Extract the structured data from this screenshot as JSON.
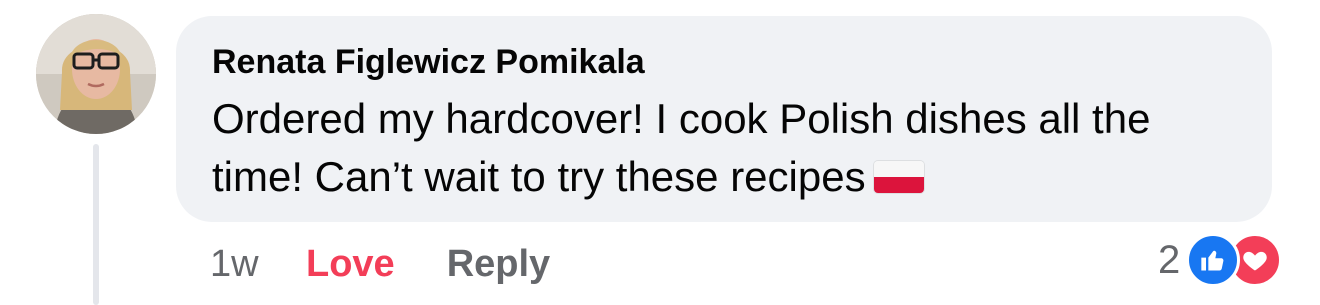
{
  "comment": {
    "author": "Renata Figlewicz Pomikala",
    "text": "Ordered my hardcover! I cook Polish dishes all the time! Can’t wait to try these recipes",
    "emoji": "poland-flag",
    "timestamp": "1w",
    "love_label": "Love",
    "reply_label": "Reply",
    "reaction_count": "2",
    "reactions": [
      "like-icon",
      "heart-icon"
    ]
  },
  "colors": {
    "bubble": "#f0f2f5",
    "love_active": "#f33e58",
    "like_blue": "#1877f2",
    "secondary_text": "#65676b"
  }
}
